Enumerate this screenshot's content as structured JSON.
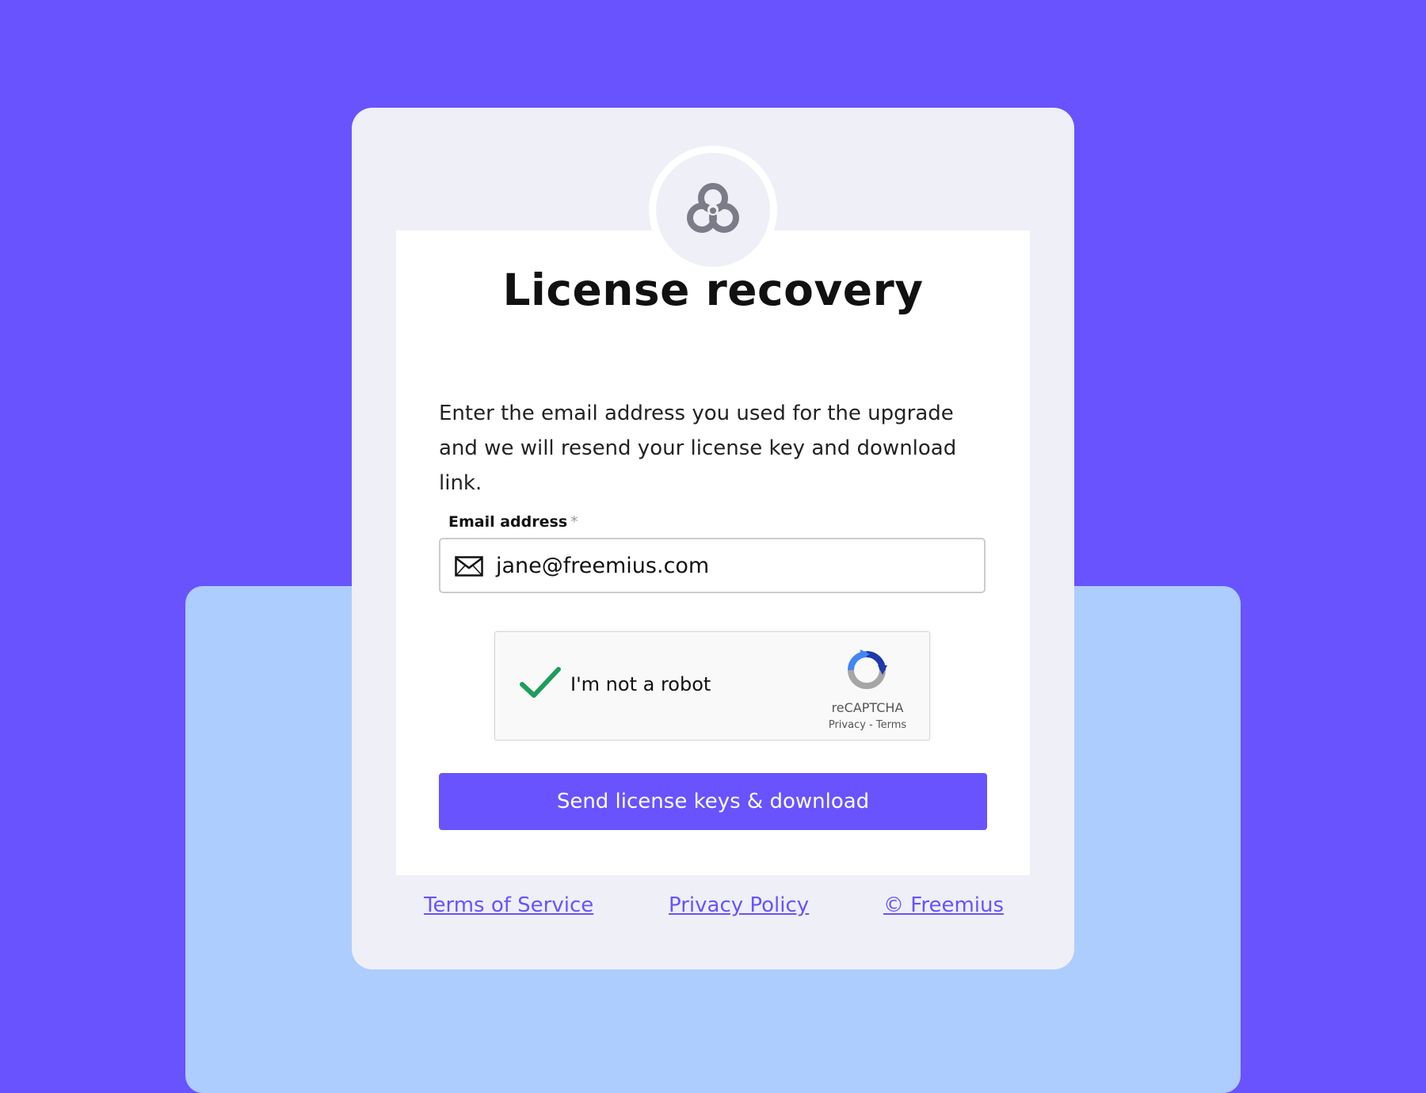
{
  "title": "License recovery",
  "description": "Enter the email address you used for the upgrade and we will resend your license key and download link.",
  "email": {
    "label": "Email address",
    "required_marker": "*",
    "value": "jane@freemius.com",
    "icon": "mail-icon"
  },
  "captcha": {
    "label": "I'm not a robot",
    "checked": true,
    "brand": "reCAPTCHA",
    "links": "Privacy - Terms"
  },
  "submit_button": "Send license keys & download",
  "footer": {
    "terms": "Terms of Service",
    "privacy": "Privacy Policy",
    "copyright": "© Freemius"
  },
  "colors": {
    "background": "#6853ff",
    "accent": "#6853ff",
    "secondary_panel": "#aecdff",
    "card": "#efeff8",
    "checkmark": "#1e9e5c"
  }
}
